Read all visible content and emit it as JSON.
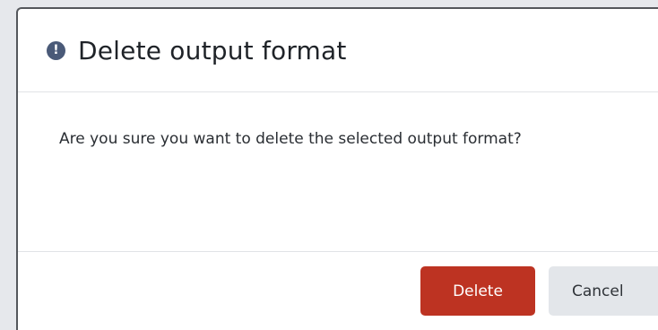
{
  "dialog": {
    "title": "Delete output format",
    "icon": "exclamation-circle-icon",
    "message": "Are you sure you want to delete the selected output format?",
    "buttons": {
      "delete_label": "Delete",
      "cancel_label": "Cancel"
    },
    "colors": {
      "delete_button": "#bd3322",
      "cancel_button": "#e3e6ea",
      "icon": "#4a5a78"
    }
  }
}
